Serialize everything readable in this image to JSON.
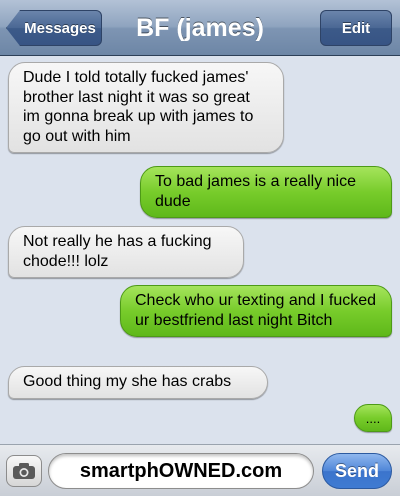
{
  "navbar": {
    "back_label": "Messages",
    "title": "BF (james)",
    "edit_label": "Edit"
  },
  "messages": [
    {
      "direction": "received",
      "text": "Dude I told totally fucked james' brother last night it was so great im gonna break up with james to go out with him"
    },
    {
      "direction": "sent",
      "text": "To bad james is a really nice dude"
    },
    {
      "direction": "received",
      "text": "Not really he has a fucking chode!!! lolz"
    },
    {
      "direction": "sent",
      "text": "Check who ur texting and I fucked ur bestfriend last night Bitch"
    },
    {
      "direction": "received",
      "text": "Good thing my she has crabs"
    },
    {
      "direction": "sent",
      "text": "...."
    }
  ],
  "input_bar": {
    "camera_icon": "camera-icon",
    "input_value": "smartphOWNED.com",
    "send_label": "Send"
  },
  "colors": {
    "sent_bubble": "#78cc2b",
    "received_bubble": "#e6e6e6",
    "background": "#dbe2ed",
    "nav_bar": "#8fa4bf",
    "send_button": "#4f86d8"
  }
}
